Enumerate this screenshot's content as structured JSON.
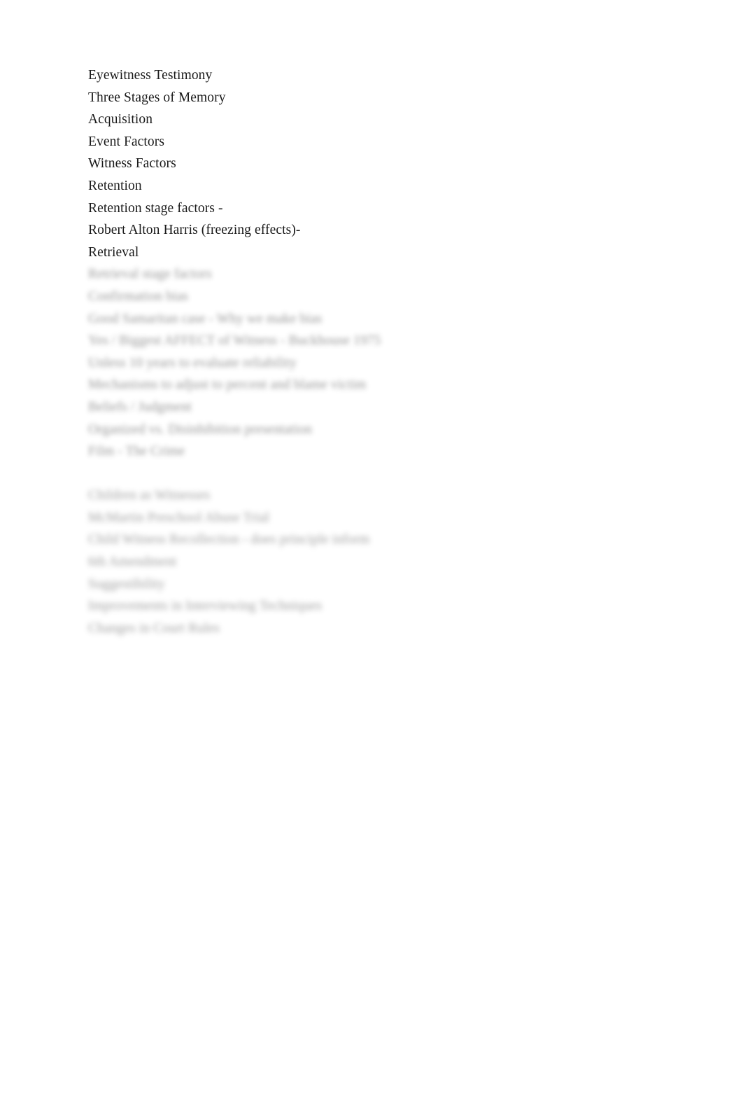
{
  "document": {
    "page_background": "#ffffff",
    "text_color": "#1a1a1a",
    "blurred_text_color": "#8d8d8d",
    "legible_lines": [
      "Eyewitness Testimony",
      "Three Stages of Memory",
      "Acquisition",
      "Event Factors",
      "Witness Factors",
      "Retention",
      "Retention stage factors -",
      "Robert Alton Harris (freezing effects)-",
      "Retrieval"
    ],
    "obscured_block_one": [
      "Retrieval stage factors",
      "Confirmation bias",
      "Good Samaritan case - Why we make bias",
      "Yes / Biggest AFFECT of Witness - Buckhouse 1975",
      "Unless 10 years to evaluate reliability",
      "Mechanisms to adjust to percent and blame victim",
      "Beliefs / Judgment",
      "Organized vs. Disinhibition presentation",
      "Film - The Crime"
    ],
    "obscured_block_two": [
      "Children as Witnesses",
      "McMartin Preschool Abuse Trial",
      "Child Witness Recollection - does principle inform",
      "6th Amendment",
      "Suggestibility",
      "Improvements in Interviewing Techniques",
      "Changes in Court Rules"
    ]
  }
}
